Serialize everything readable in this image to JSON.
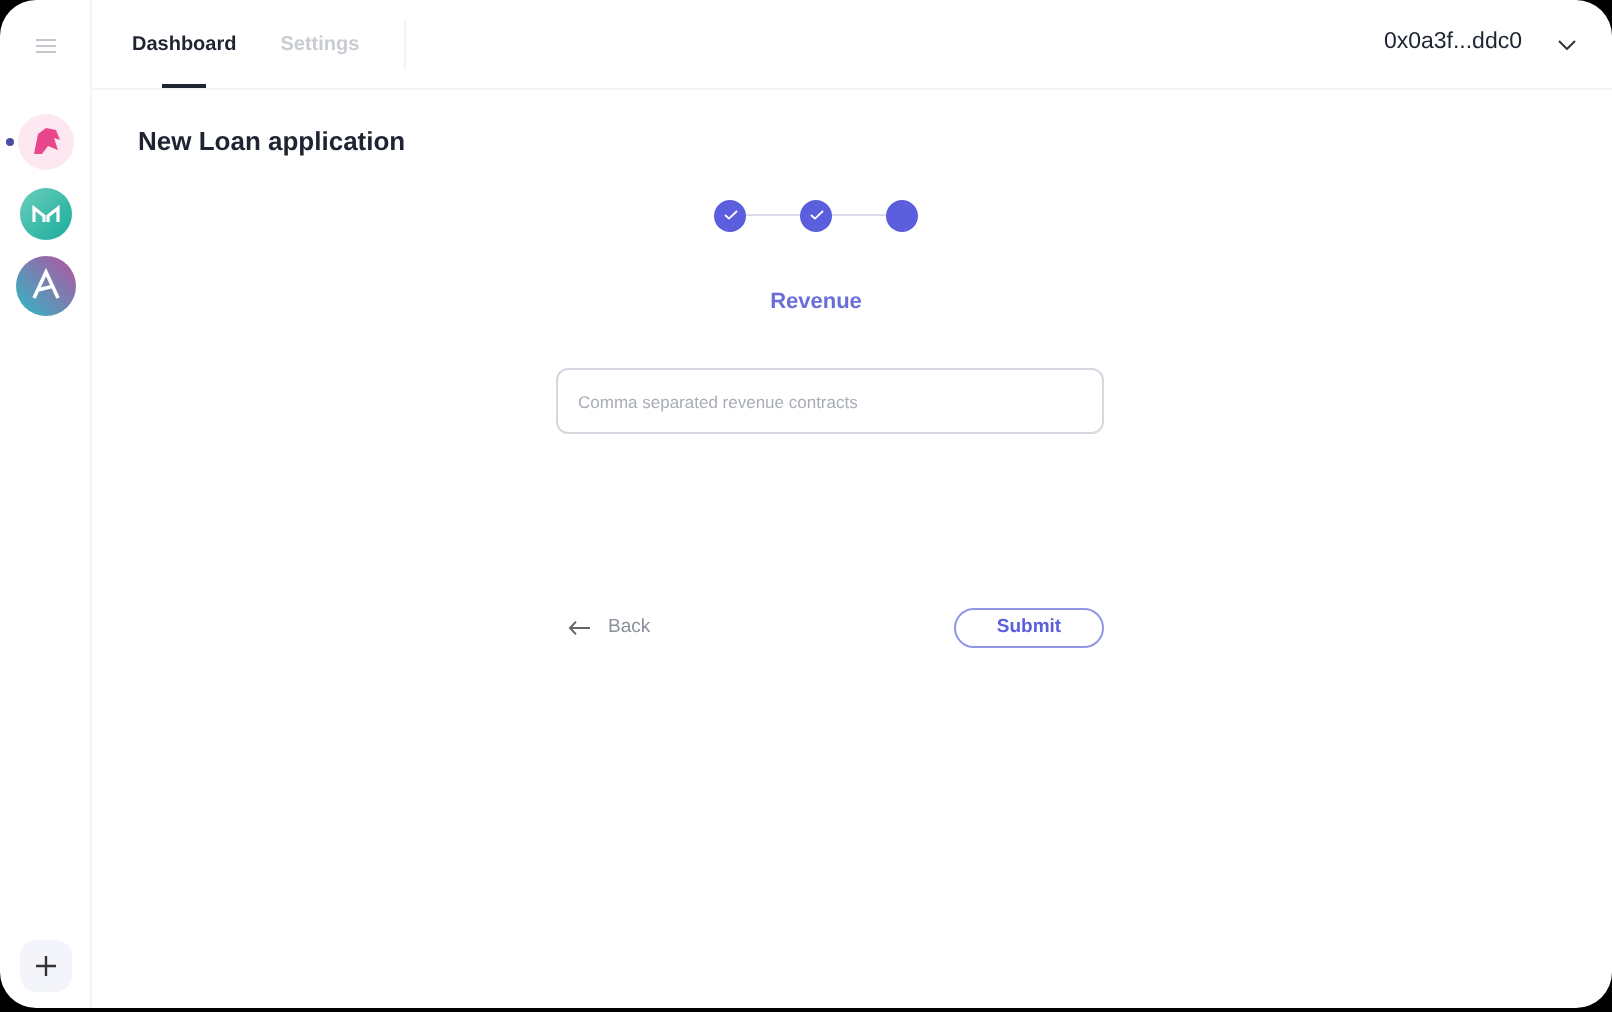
{
  "sidebar": {
    "apps": [
      {
        "kind": "unicorn",
        "selected": true
      },
      {
        "kind": "maker",
        "selected": false
      },
      {
        "kind": "aave",
        "selected": false
      }
    ]
  },
  "tabs": [
    {
      "label": "Dashboard",
      "selected": true
    },
    {
      "label": "Settings",
      "selected": false
    }
  ],
  "account": {
    "address": "0x0a3f...ddc0"
  },
  "title": "New Loan application",
  "steps": [
    {
      "completed": true
    },
    {
      "completed": true
    },
    {
      "completed": false
    }
  ],
  "step_title": "Revenue",
  "field": {
    "placeholder": "Comma separated revenue contracts"
  },
  "back": "Back",
  "submit": "Submit"
}
